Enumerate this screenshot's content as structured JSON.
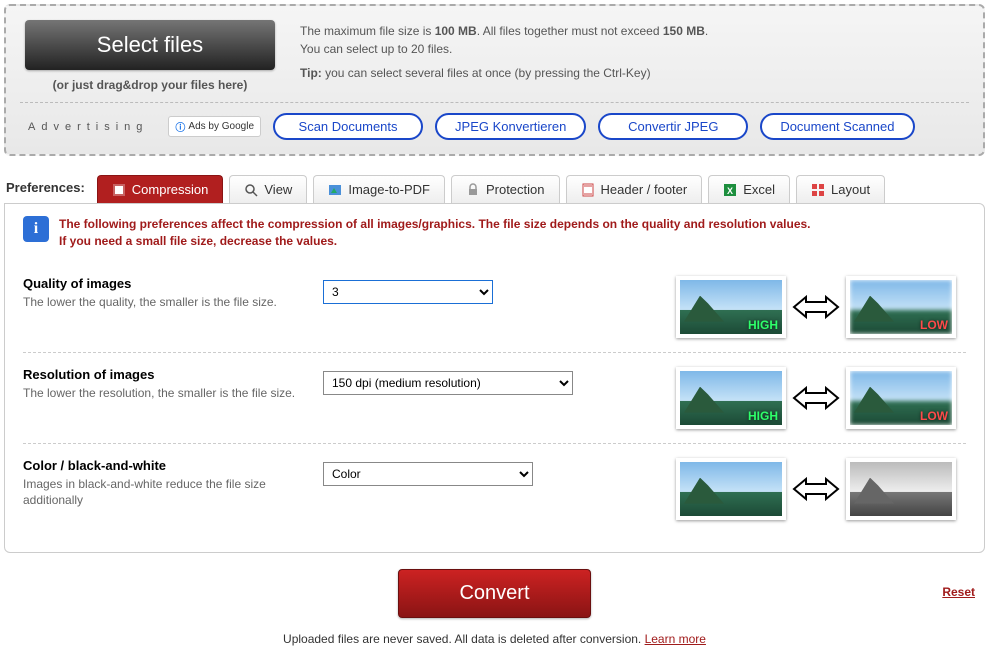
{
  "upload": {
    "select_label": "Select files",
    "drag_hint": "(or just drag&drop your files here)",
    "max_line_prefix": "The maximum file size is ",
    "max_size": "100 MB",
    "max_line_mid": ". All files together must not exceed ",
    "max_total": "150 MB",
    "max_line_suffix": ".",
    "max_files": "You can select up to 20 files.",
    "tip_label": "Tip:",
    "tip_text": " you can select several files at once (by pressing the Ctrl-Key)"
  },
  "ads": {
    "label": "Advertising",
    "badge": "Ads by Google",
    "links": [
      "Scan Documents",
      "JPEG Konvertieren",
      "Convertir JPEG",
      "Document Scanned"
    ]
  },
  "prefs_label": "Preferences:",
  "tabs": [
    "Compression",
    "View",
    "Image-to-PDF",
    "Protection",
    "Header / footer",
    "Excel",
    "Layout"
  ],
  "note": {
    "line1": "The following preferences affect the compression of all images/graphics. The file size depends on the quality and resolution values.",
    "line2": "If you need a small file size, decrease the values."
  },
  "options": {
    "quality": {
      "title": "Quality of images",
      "desc": "The lower the quality, the smaller is the file size.",
      "value": "3"
    },
    "resolution": {
      "title": "Resolution of images",
      "desc": "The lower the resolution, the smaller is the file size.",
      "value": "150 dpi (medium resolution)"
    },
    "color": {
      "title": "Color / black-and-white",
      "desc": "Images in black-and-white reduce the file size additionally",
      "value": "Color"
    }
  },
  "visual": {
    "high": "HIGH",
    "low": "LOW"
  },
  "convert_label": "Convert",
  "reset_label": "Reset",
  "footer": {
    "text": "Uploaded files are never saved. All data is deleted after conversion. ",
    "learn_more": "Learn more"
  }
}
